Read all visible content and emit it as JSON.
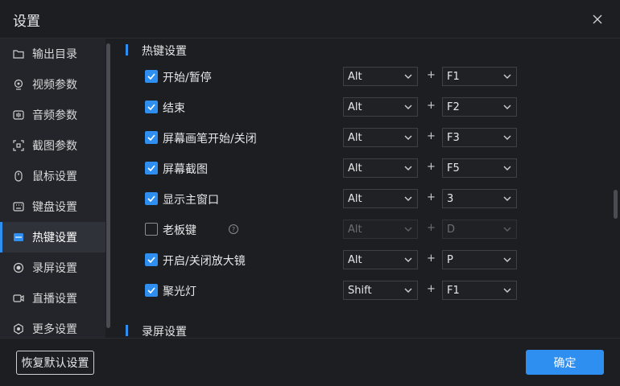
{
  "window": {
    "title": "设置"
  },
  "sidebar": {
    "items": [
      {
        "label": "输出目录",
        "icon": "folder-icon"
      },
      {
        "label": "视频参数",
        "icon": "camera-icon"
      },
      {
        "label": "音频参数",
        "icon": "audio-icon"
      },
      {
        "label": "截图参数",
        "icon": "screenshot-icon"
      },
      {
        "label": "鼠标设置",
        "icon": "mouse-icon"
      },
      {
        "label": "键盘设置",
        "icon": "keyboard-icon"
      },
      {
        "label": "热键设置",
        "icon": "hotkey-icon",
        "active": true
      },
      {
        "label": "录屏设置",
        "icon": "record-icon"
      },
      {
        "label": "直播设置",
        "icon": "live-icon"
      },
      {
        "label": "更多设置",
        "icon": "more-settings-icon"
      }
    ]
  },
  "main": {
    "section_hotkeys": "热键设置",
    "section_record": "录屏设置",
    "plus": "+",
    "rows": [
      {
        "label": "开始/暂停",
        "checked": true,
        "mod": "Alt",
        "key": "F1"
      },
      {
        "label": "结束",
        "checked": true,
        "mod": "Alt",
        "key": "F2"
      },
      {
        "label": "屏幕画笔开始/关闭",
        "checked": true,
        "mod": "Alt",
        "key": "F3"
      },
      {
        "label": "屏幕截图",
        "checked": true,
        "mod": "Alt",
        "key": "F5"
      },
      {
        "label": "显示主窗口",
        "checked": true,
        "mod": "Alt",
        "key": "3"
      },
      {
        "label": "老板键",
        "checked": false,
        "mod": "Alt",
        "key": "D",
        "help": "?"
      },
      {
        "label": "开启/关闭放大镜",
        "checked": true,
        "mod": "Alt",
        "key": "P"
      },
      {
        "label": "聚光灯",
        "checked": true,
        "mod": "Shift",
        "key": "F1"
      }
    ]
  },
  "footer": {
    "reset_label": "恢复默认设置",
    "ok_label": "确定"
  },
  "colors": {
    "accent": "#2e8ff0",
    "background": "#1c1e22",
    "sidebar": "#23252a"
  }
}
